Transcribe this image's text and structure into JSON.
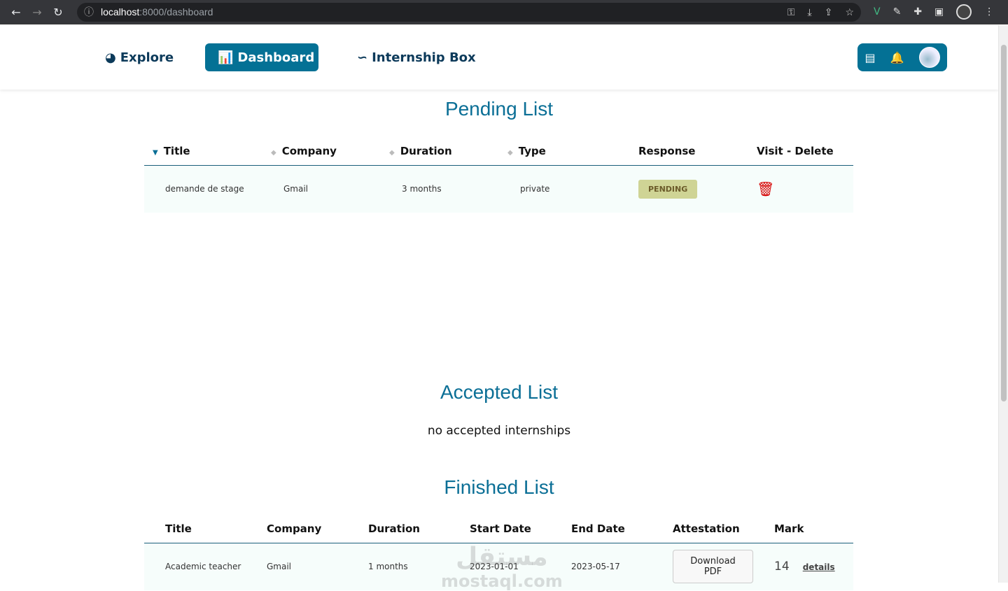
{
  "browser": {
    "url_host": "localhost",
    "url_path": ":8000/dashboard"
  },
  "nav": {
    "explore": "Explore",
    "dashboard": "Dashboard",
    "internship_box": "Internship Box"
  },
  "pending": {
    "title": "Pending List",
    "columns": [
      "Title",
      "Company",
      "Duration",
      "Type",
      "Response",
      "Visit - Delete"
    ],
    "rows": [
      {
        "title": "demande de stage",
        "company": "Gmail",
        "duration": "3 months",
        "type": "private",
        "response": "PENDING"
      }
    ]
  },
  "accepted": {
    "title": "Accepted List",
    "empty": "no accepted internships"
  },
  "finished": {
    "title": "Finished List",
    "columns": [
      "Title",
      "Company",
      "Duration",
      "Start Date",
      "End Date",
      "Attestation",
      "Mark"
    ],
    "rows": [
      {
        "title": "Academic teacher",
        "company": "Gmail",
        "duration": "1 months",
        "start": "2023-01-01",
        "end": "2023-05-17",
        "attestation": "Download PDF",
        "mark": "14",
        "details": "details"
      }
    ]
  },
  "watermark": {
    "arabic": "مستقل",
    "latin": "mostaql.com"
  },
  "colors": {
    "primary": "#047195",
    "pending_badge": "#cfd495",
    "delete": "#d60000"
  }
}
